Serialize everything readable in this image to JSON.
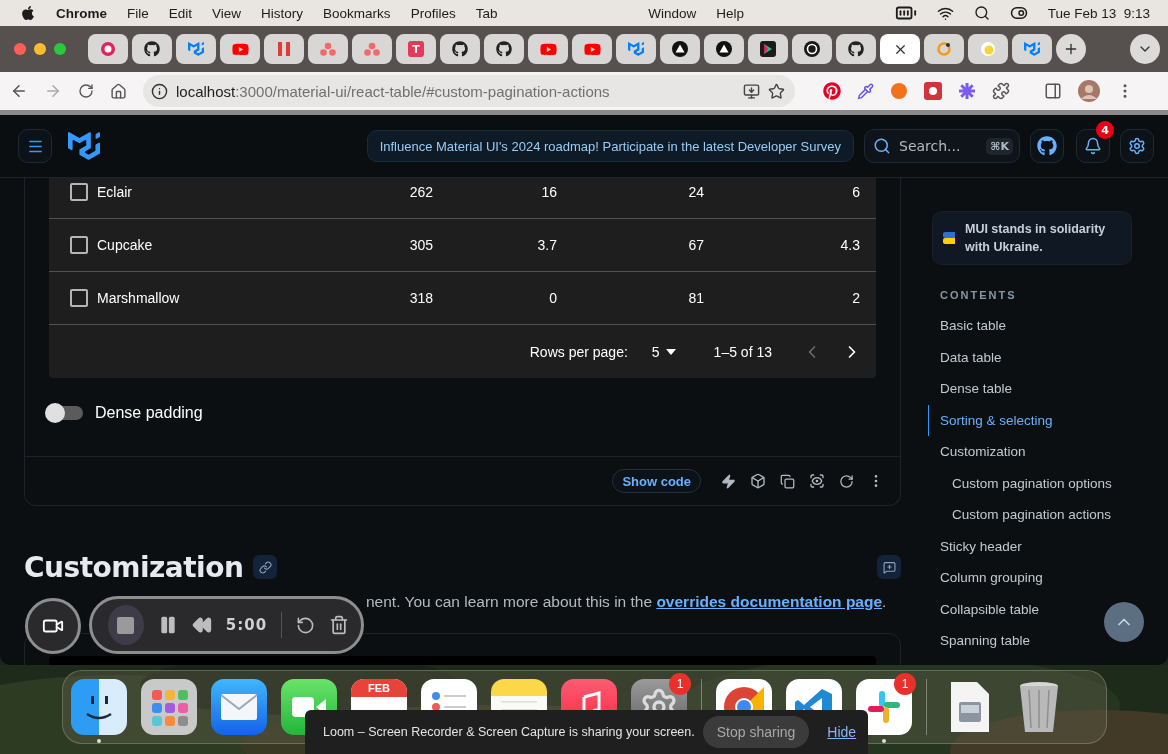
{
  "menu_bar": {
    "app": "Chrome",
    "menus": [
      "File",
      "Edit",
      "View",
      "History",
      "Bookmarks",
      "Profiles",
      "Tab"
    ],
    "right_menus": [
      "Window",
      "Help"
    ],
    "clock": "Tue Feb 13  9:13"
  },
  "browser": {
    "tabs": [
      {
        "kind": "record",
        "selected": false
      },
      {
        "kind": "github",
        "selected": false
      },
      {
        "kind": "mui",
        "selected": false
      },
      {
        "kind": "youtube",
        "selected": false
      },
      {
        "kind": "pause",
        "selected": false
      },
      {
        "kind": "dots",
        "selected": false
      },
      {
        "kind": "dots",
        "selected": false
      },
      {
        "kind": "letter",
        "letter": "T",
        "selected": false
      },
      {
        "kind": "github",
        "selected": false
      },
      {
        "kind": "github",
        "selected": false
      },
      {
        "kind": "youtube",
        "selected": false
      },
      {
        "kind": "youtube",
        "selected": false
      },
      {
        "kind": "mui",
        "selected": false
      },
      {
        "kind": "triangle",
        "selected": false
      },
      {
        "kind": "triangle",
        "selected": false
      },
      {
        "kind": "arrow",
        "selected": false
      },
      {
        "kind": "circle",
        "selected": false
      },
      {
        "kind": "github",
        "selected": false
      },
      {
        "kind": "blank",
        "selected": true
      },
      {
        "kind": "ring",
        "selected": false
      },
      {
        "kind": "sun",
        "selected": false
      },
      {
        "kind": "mui",
        "selected": false
      }
    ],
    "address": {
      "host": "localhost",
      "path": ":3000/material-ui/react-table/#custom-pagination-actions"
    }
  },
  "header": {
    "banner": "Influence Material UI's 2024 roadmap! Participate in the latest Developer Survey",
    "search": {
      "placeholder": "Search...",
      "shortcut": "⌘K"
    },
    "notifications": "4"
  },
  "table": {
    "rows": [
      {
        "name": "Eclair",
        "checked": false,
        "cells": [
          "262",
          "16",
          "24",
          "6"
        ]
      },
      {
        "name": "Cupcake",
        "checked": false,
        "cells": [
          "305",
          "3.7",
          "67",
          "4.3"
        ]
      },
      {
        "name": "Marshmallow",
        "checked": false,
        "cells": [
          "318",
          "0",
          "81",
          "2"
        ]
      }
    ],
    "pagination": {
      "label": "Rows per page:",
      "per_page": "5",
      "range": "1–5 of 13"
    }
  },
  "dense_padding": {
    "label": "Dense padding",
    "on": false
  },
  "show_code": "Show code",
  "section": {
    "title": "Customization",
    "text": "nent. You can learn more about this in the ",
    "link": "overrides documentation page",
    "end": "."
  },
  "recorder": {
    "time": "5:00"
  },
  "sidebar": {
    "notice": "MUI stands in solidarity with Ukraine.",
    "heading": "CONTENTS",
    "items": [
      {
        "label": "Basic table",
        "selected": false
      },
      {
        "label": "Data table",
        "selected": false
      },
      {
        "label": "Dense table",
        "selected": false
      },
      {
        "label": "Sorting & selecting",
        "selected": true
      },
      {
        "label": "Customization",
        "selected": false,
        "children": [
          {
            "label": "Custom pagination options",
            "selected": false
          },
          {
            "label": "Custom pagination actions",
            "selected": false
          }
        ]
      },
      {
        "label": "Sticky header",
        "selected": false
      },
      {
        "label": "Column grouping",
        "selected": false
      },
      {
        "label": "Collapsible table",
        "selected": false
      },
      {
        "label": "Spanning table",
        "selected": false
      }
    ]
  },
  "dock": {
    "calendar_month": "FEB",
    "apps": [
      {
        "kind": "finder",
        "running": true
      },
      {
        "kind": "launchpad",
        "running": false
      },
      {
        "kind": "mail",
        "running": false
      },
      {
        "kind": "facetime"
      },
      {
        "kind": "calendar"
      },
      {
        "kind": "reminders"
      },
      {
        "kind": "notes"
      },
      {
        "kind": "music"
      },
      {
        "kind": "settings",
        "badge": "1"
      },
      {
        "kind": "separator"
      },
      {
        "kind": "chrome"
      },
      {
        "kind": "vscode"
      },
      {
        "kind": "slack",
        "running": true,
        "badge": "1"
      },
      {
        "kind": "separator"
      },
      {
        "kind": "document",
        "running": false
      },
      {
        "kind": "trash",
        "running": false
      }
    ]
  },
  "sharing_bar": {
    "message": "Loom – Screen Recorder & Screen Capture is sharing your screen.",
    "stop": "Stop sharing",
    "hide": "Hide"
  }
}
